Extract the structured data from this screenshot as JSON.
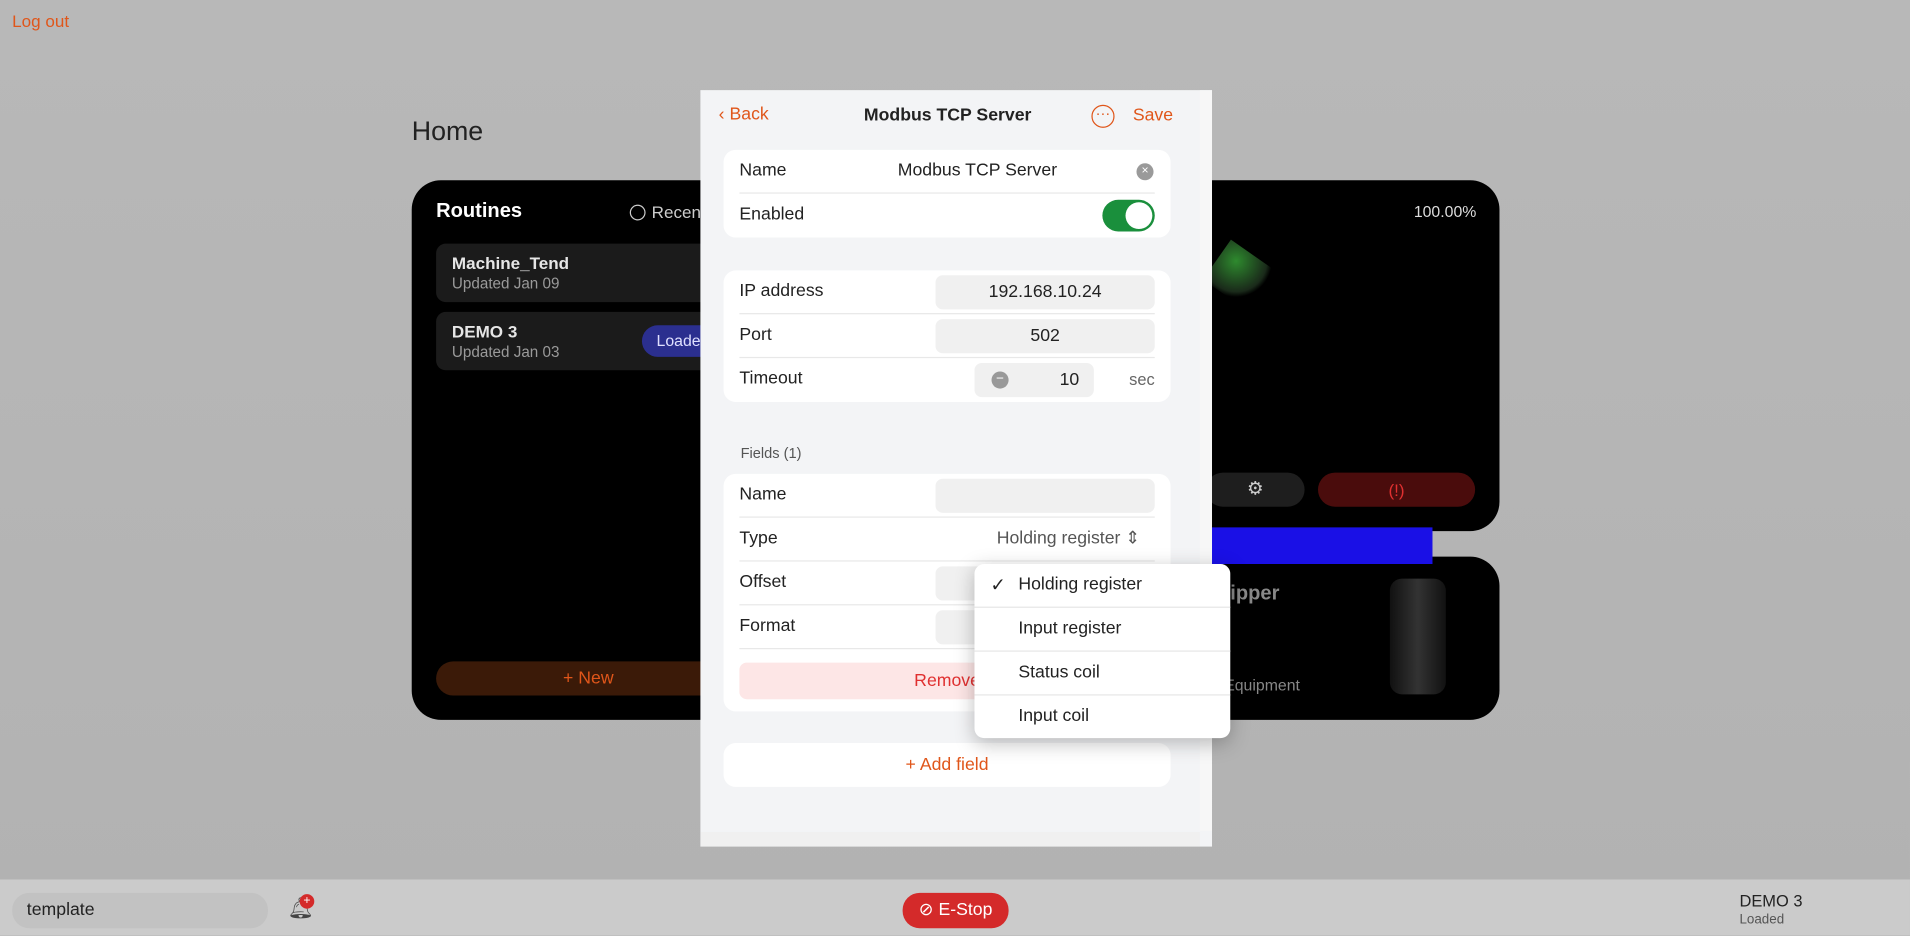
{
  "top": {
    "logout": "Log out"
  },
  "home": {
    "title": "Home"
  },
  "routines": {
    "title": "Routines",
    "filter": "Recen",
    "items": [
      {
        "name": "Machine_Tend",
        "updated": "Updated Jan 09"
      },
      {
        "name": "DEMO 3",
        "updated": "Updated Jan 03",
        "badge": "Loaded"
      }
    ],
    "new_label": "New"
  },
  "robot": {
    "percent": "100.00%"
  },
  "gripper": {
    "title": "ipper",
    "subtitle": "Equipment"
  },
  "panel": {
    "back": "Back",
    "title": "Modbus TCP Server",
    "save": "Save",
    "name_label": "Name",
    "name_value": "Modbus TCP Server",
    "enabled_label": "Enabled",
    "enabled": true,
    "ip_label": "IP address",
    "ip_value": "192.168.10.24",
    "port_label": "Port",
    "port_value": "502",
    "timeout_label": "Timeout",
    "timeout_value": "10",
    "timeout_unit": "sec",
    "fields_header": "Fields (1)",
    "field": {
      "name_label": "Name",
      "name_value": "",
      "type_label": "Type",
      "type_value": "Holding register",
      "offset_label": "Offset",
      "format_label": "Format",
      "remove": "Remove"
    },
    "add_field": "Add field"
  },
  "dropdown": {
    "selected": "Holding register",
    "options": [
      "Holding register",
      "Input register",
      "Status coil",
      "Input coil"
    ]
  },
  "bottom": {
    "search_value": "template",
    "notification_badge": "+",
    "estop": "E-Stop",
    "routine_name": "DEMO 3",
    "routine_status": "Loaded"
  },
  "colors": {
    "accent": "#e0561a",
    "toggle": "#1a8f3c",
    "estop": "#d42a2a",
    "arrow": "#1a10e6",
    "badge": "#2b2f8f"
  }
}
